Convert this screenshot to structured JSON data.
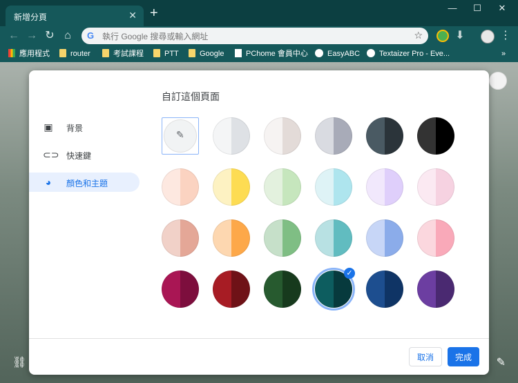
{
  "browser": {
    "tab_title": "新增分頁",
    "tab_close": "✕",
    "new_tab": "+",
    "win_min": "—",
    "win_max": "☐",
    "win_close": "✕",
    "nav_back": "←",
    "nav_forward": "→",
    "nav_reload": "↻",
    "nav_home": "⌂",
    "omnibox_placeholder": "執行 Google 搜尋或輸入網址",
    "omnibox_g": "G",
    "star": "☆",
    "menu_dots": "⋮"
  },
  "bookmarks": {
    "apps": "應用程式",
    "items": [
      "router",
      "考試課程",
      "PTT",
      "Google",
      "PChome 會員中心",
      "EasyABC",
      "Textaizer Pro - Eve..."
    ],
    "more": "»"
  },
  "dialog": {
    "title": "自訂這個頁面",
    "nav": [
      {
        "label": "背景",
        "icon": "image-icon"
      },
      {
        "label": "快速鍵",
        "icon": "link-icon"
      },
      {
        "label": "顏色和主題",
        "icon": "palette-icon"
      }
    ],
    "cancel_label": "取消",
    "done_label": "完成",
    "selected_swatch": "row4-col4",
    "swatches": [
      [
        null,
        [
          "#f4f5f6",
          "#dee1e5"
        ],
        [
          "#f6f3f2",
          "#e3dbd8"
        ],
        [
          "#d9dbe1",
          "#a8abb8"
        ],
        [
          "#4a5a63",
          "#2b343a"
        ],
        [
          "#333333",
          "#000000"
        ]
      ],
      [
        [
          "#fde8e0",
          "#fbd3c1"
        ],
        [
          "#fdf2c2",
          "#fddc53"
        ],
        [
          "#e3f1de",
          "#c6e6bd"
        ],
        [
          "#def3f6",
          "#aee5ee"
        ],
        [
          "#f1e8fc",
          "#dfcffb"
        ],
        [
          "#fbe9f2",
          "#f6d2e1"
        ]
      ],
      [
        [
          "#f1d1c8",
          "#e4a797"
        ],
        [
          "#fdd7b0",
          "#fda849"
        ],
        [
          "#c6e0c9",
          "#7fbe84"
        ],
        [
          "#b8e1e3",
          "#61bcc0"
        ],
        [
          "#c7d6f7",
          "#8bacea"
        ],
        [
          "#fbd7de",
          "#f9a9b9"
        ]
      ],
      [
        [
          "#a91654",
          "#7d0e3d"
        ],
        [
          "#a71c24",
          "#6f1217"
        ],
        [
          "#275a2f",
          "#173a1d"
        ],
        [
          "#0d5d5f",
          "#073a3d"
        ],
        [
          "#1d4e8f",
          "#0f3465"
        ],
        [
          "#6c3ea1",
          "#4a2971"
        ]
      ]
    ]
  }
}
